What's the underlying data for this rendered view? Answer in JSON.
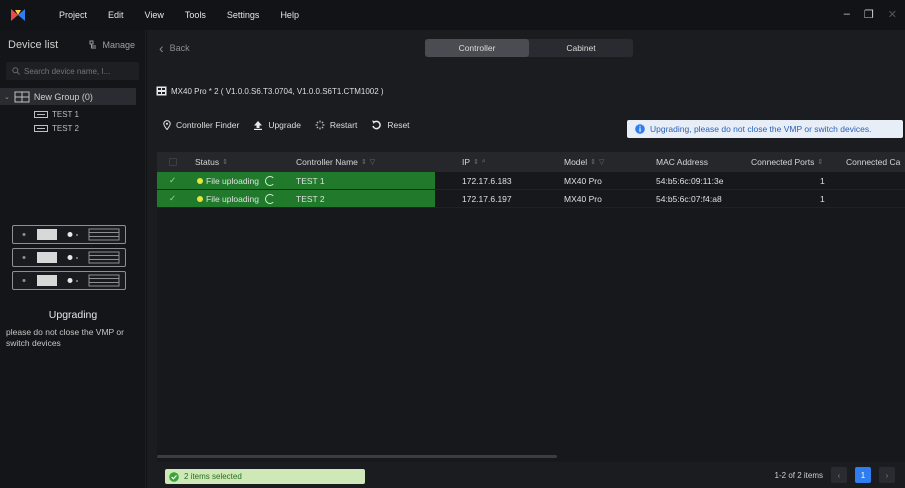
{
  "menubar": {
    "items": [
      "Project",
      "Edit",
      "View",
      "Tools",
      "Settings",
      "Help"
    ],
    "win_controls": [
      "–",
      "❐",
      "✕"
    ]
  },
  "sidebar": {
    "title": "Device list",
    "manage_label": "Manage",
    "search_placeholder": "Search device name, I...",
    "group_label": "New Group (0)",
    "devices": [
      "TEST 1",
      "TEST 2"
    ],
    "upgrading_title": "Upgrading",
    "upgrading_desc": "please do not close the VMP or switch devices"
  },
  "main": {
    "back_label": "Back",
    "tabs": [
      {
        "label": "Controller",
        "active": true
      },
      {
        "label": "Cabinet",
        "active": false
      }
    ],
    "device_title": "MX40 Pro * 2 ( V1.0.0.S6.T3.0704, V1.0.0.S6T1.CTM1002 )",
    "toolbar": {
      "finder": "Controller Finder",
      "upgrade": "Upgrade",
      "restart": "Restart",
      "reset": "Reset"
    },
    "notice": "Upgrading, please do not close the VMP or switch devices.",
    "columns": {
      "status": "Status",
      "name": "Controller Name",
      "ip": "IP",
      "model": "Model",
      "mac": "MAC Address",
      "ports": "Connected Ports",
      "cabinets": "Connected Ca"
    },
    "rows": [
      {
        "status": "File uploading",
        "name": "TEST 1",
        "ip": "172.17.6.183",
        "model": "MX40 Pro",
        "mac": "54:b5:6c:09:11:3e",
        "ports": "1"
      },
      {
        "status": "File uploading",
        "name": "TEST 2",
        "ip": "172.17.6.197",
        "model": "MX40 Pro",
        "mac": "54:b5:6c:07:f4:a8",
        "ports": "1"
      }
    ],
    "footer": {
      "selected": "2 items selected",
      "range": "1-2 of 2 items",
      "page": "1",
      "prev": "‹",
      "next": "›"
    }
  },
  "colors": {
    "accent": "#2f7dee",
    "row_highlight": "#217a2c",
    "status_dot": "#e6e63a"
  }
}
